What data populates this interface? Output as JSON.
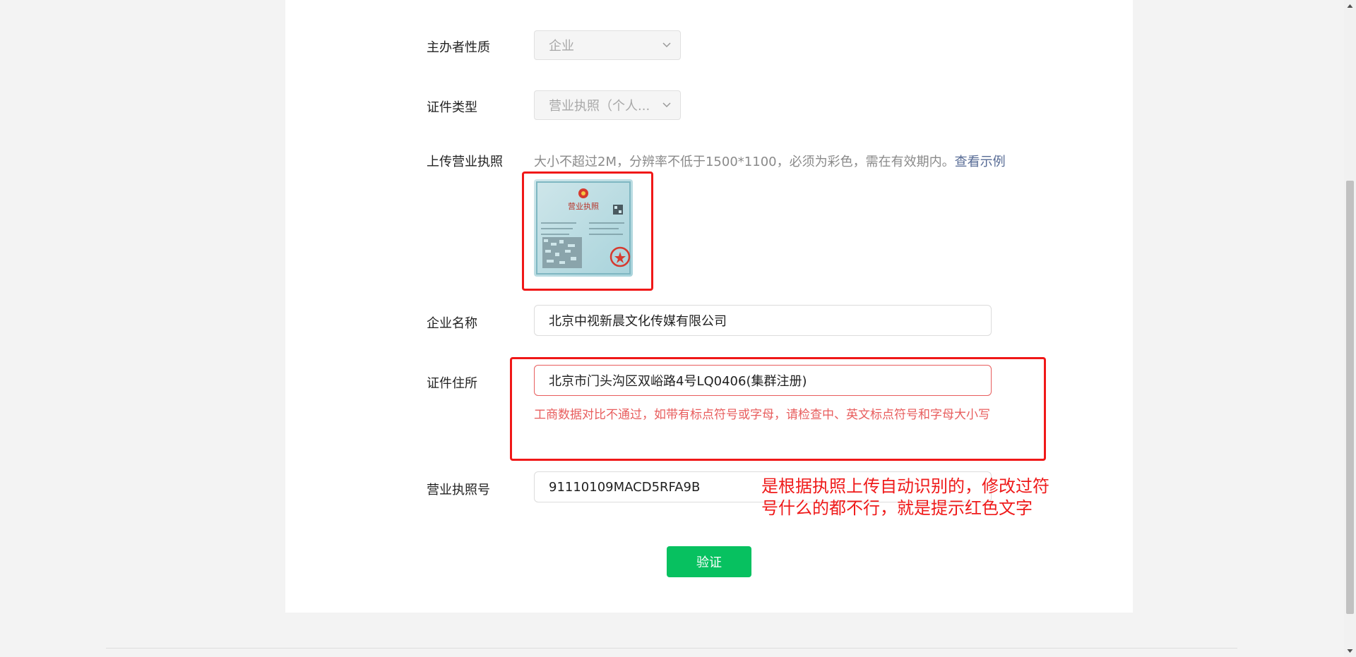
{
  "form": {
    "host_nature": {
      "label": "主办者性质",
      "value": "企业"
    },
    "cert_type": {
      "label": "证件类型",
      "value": "营业执照（个人..."
    },
    "upload": {
      "label": "上传营业执照",
      "hint": "大小不超过2M，分辨率不低于1500*1100，必须为彩色，需在有效期内。",
      "example_link": "查看示例",
      "thumb_title": "营业执照"
    },
    "company_name": {
      "label": "企业名称",
      "value": "北京中视新晨文化传媒有限公司"
    },
    "cert_address": {
      "label": "证件住所",
      "value": "北京市门头沟区双峪路4号LQ0406(集群注册)",
      "error": "工商数据对比不通过，如带有标点符号或字母，请检查中、英文标点符号和字母大小写"
    },
    "license_no": {
      "label": "营业执照号",
      "value": "91110109MACD5RFA9B"
    },
    "verify_button": "验证"
  },
  "annotation": {
    "text": "是根据执照上传自动识别的，修改过符号什么的都不行，就是提示红色文字",
    "color": "#ef1a1a"
  },
  "colors": {
    "primary_button": "#07c160",
    "error": "#e85d5d",
    "link": "#576b95"
  },
  "icons": {
    "select_arrow": "chevron-down-icon"
  }
}
